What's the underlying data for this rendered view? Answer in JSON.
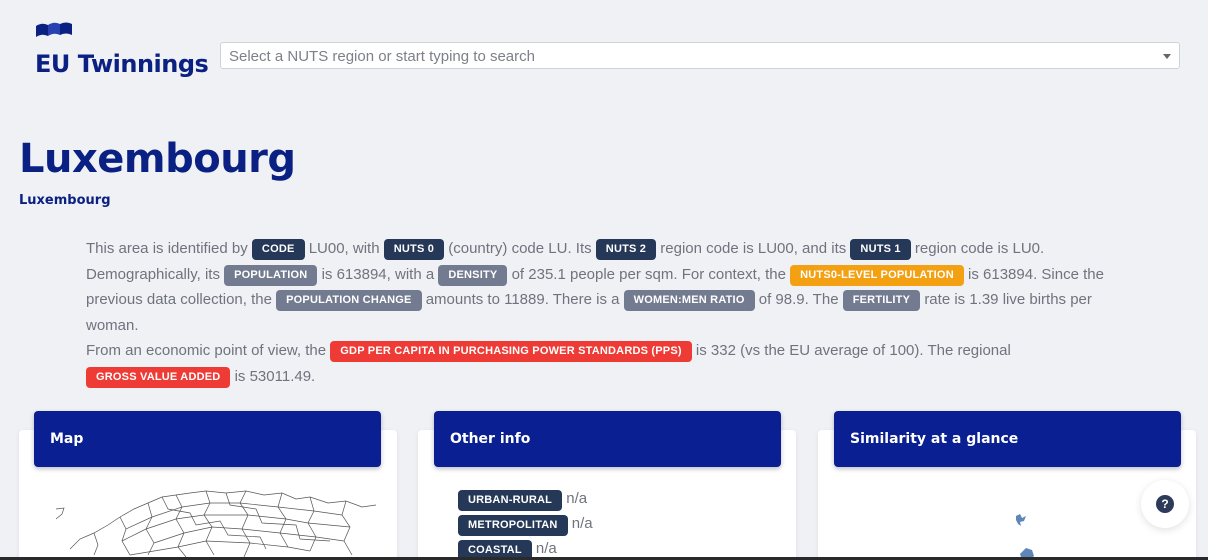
{
  "header": {
    "logo_text": "EU Twinnings",
    "search_placeholder": "Select a NUTS region or start typing to search"
  },
  "region": {
    "name": "Luxembourg",
    "country": "Luxembourg"
  },
  "description": {
    "l1_a": "This area is identified by",
    "b_code": "CODE",
    "l1_b": "LU00, with",
    "b_nuts0": "NUTS 0",
    "l1_c": "(country) code LU. Its",
    "b_nuts2": "NUTS 2",
    "l1_d": "region code is LU00, and its",
    "b_nuts1": "NUTS 1",
    "l1_e": "region code is LU0.",
    "l2_a": "Demographically, its",
    "b_population": "POPULATION",
    "l2_b": "is 613894, with a",
    "b_density": "DENSITY",
    "l2_c": "of 235.1 people per sqm. For context, the",
    "b_nuts0_pop": "NUTS0-LEVEL POPULATION",
    "l2_d": "is 613894. Since the",
    "l3_a": "previous data collection, the",
    "b_pop_change": "POPULATION CHANGE",
    "l3_b": "amounts to 11889. There is a",
    "b_ratio": "WOMEN:MEN RATIO",
    "l3_c": "of 98.9. The",
    "b_fertility": "FERTILITY",
    "l3_d": "rate is 1.39 live births per",
    "l4": "woman.",
    "l5_a": "From an economic point of view, the",
    "b_gdp": "GDP PER CAPITA IN PURCHASING POWER STANDARDS (PPS)",
    "l5_b": "is 332 (vs the EU average of 100). The regional",
    "b_gva": "GROSS VALUE ADDED",
    "l6": "is 53011.49."
  },
  "cards": {
    "map_title": "Map",
    "other_title": "Other info",
    "similarity_title": "Similarity at a glance"
  },
  "other_info": [
    {
      "label": "URBAN-RURAL",
      "value": "n/a"
    },
    {
      "label": "METROPOLITAN",
      "value": "n/a"
    },
    {
      "label": "COASTAL",
      "value": "n/a"
    }
  ],
  "help": {
    "label": "?"
  },
  "colors": {
    "brand": "#0a2082",
    "card_header": "#0a2092",
    "badge_dark": "#253857",
    "badge_grey": "#737b90",
    "badge_orange": "#f4a013",
    "badge_red": "#ef3b36"
  },
  "icons": [
    "logo-flags-icon",
    "dropdown-caret-icon",
    "help-icon"
  ]
}
